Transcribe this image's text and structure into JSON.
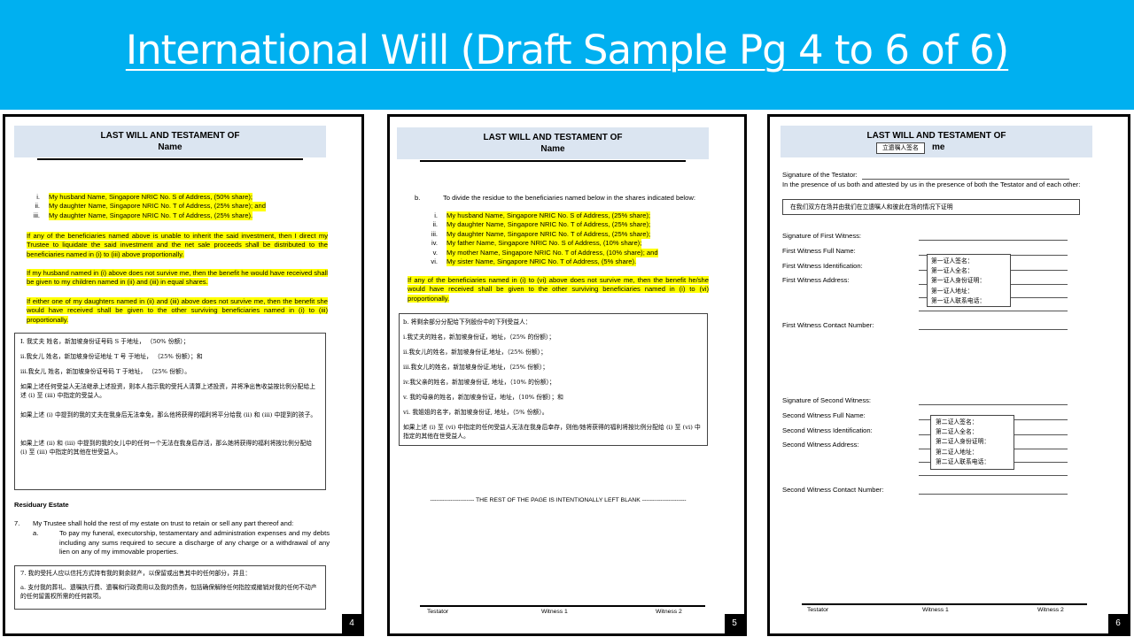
{
  "slide": {
    "title": "International Will (Draft Sample Pg 4 to 6 of 6)"
  },
  "doc": {
    "header_line1": "LAST WILL AND TESTAMENT OF",
    "header_line2": "Name"
  },
  "footer": {
    "testator": "Testator",
    "witness1": "Witness 1",
    "witness2": "Witness 2"
  },
  "p4": {
    "number": "4",
    "list": [
      {
        "num": "i.",
        "text": "My husband Name, Singapore NRIC No. S of Address, (50% share);"
      },
      {
        "num": "ii.",
        "text": "My daughter Name, Singapore NRIC No. T of Address, (25% share); and"
      },
      {
        "num": "iii.",
        "text": "My daughter Name, Singapore NRIC No. T of Address, (25% share)."
      }
    ],
    "para1": "If any of the beneficiaries named above is unable to inherit the said investment, then I direct my Trustee to liquidate the said investment and the net sale proceeds shall be distributed to the beneficiaries named in (i) to (iii) above proportionally.",
    "para2": "If my husband named in (i) above does not survive me, then the benefit he would have received shall be given to my children named in (ii) and (iii) in equal shares.",
    "para3": "If either one of my daughters named in (ii) and (iii) above does not survive me, then the benefit she would have received shall be given to the other surviving beneficiaries named in (i) to (iii) proportionally.",
    "cn_lines": [
      "I.  我丈夫 姓名，新加坡身份证号码 S 于地址， （50% 份额）；",
      "ii.我女儿 姓名，新加坡身份证地址 T 号 于地址， （25% 份额）；和",
      "iii.我女儿 姓名，新加坡身份证号码 T 于地址， （25% 份额）。"
    ],
    "cn_para1": "如果上述任何受益人无法继承上述投资，则本人指示我的受托人清算上述投资，并将净出售收益按比例分配给上述 (i) 至 (iii) 中指定的受益人。",
    "cn_para2": "如果上述 (i) 中提到的我的丈夫在我身后无法幸免，那么他将获得的福利将平分给我 (ii) 和 (iii) 中提到的孩子。",
    "cn_para3": "如果上述 (ii) 和 (iii) 中提到的我的女儿中的任何一个无法在我身后存活，那么她将获得的福利将按比例分配给 (i) 至 (iii) 中指定的其他在世受益人。",
    "residuary_heading": "Residuary Estate",
    "clause7_num": "7.",
    "clause7": "My Trustee shall hold the rest of my estate on trust to retain or sell any part thereof and:",
    "clause7a_num": "a.",
    "clause7a": "To pay my funeral, executorship, testamentary and administration expenses and my debts including any sums required to secure a discharge of any charge or a withdrawal of any lien on any of my immovable properties.",
    "cn_box2_line1": "7. 我的受托人应以信托方式持有我的剩余财产，以保留或出售其中的任何部分，并且：",
    "cn_box2_line2": "a.  支付我的葬礼、遗嘱执行费、遗嘱和行政费用以及我的债务，包括确保解除任何指控或撤销对我的任何不动产的任何留置权所需的任何款项。"
  },
  "p5": {
    "number": "5",
    "b_num": "b.",
    "b_text": "To divide the residue to the beneficiaries named below in the shares indicated below:",
    "list": [
      {
        "num": "i.",
        "text": "My husband Name, Singapore NRIC No. S of Address, (25% share);"
      },
      {
        "num": "ii.",
        "text": "My daughter Name, Singapore NRIC No. T of Address, (25% share);"
      },
      {
        "num": "iii.",
        "text": "My daughter Name, Singapore NRIC No. T of Address, (25% share);"
      },
      {
        "num": "iv.",
        "text": "My father Name, Singapore NRIC No. S of Address, (10% share);"
      },
      {
        "num": "v.",
        "text": "My mother Name, Singapore NRIC No. T of Address, (10% share); and"
      },
      {
        "num": "vi.",
        "text": "My sister Name, Singapore NRIC No. T of Address, (5% share)."
      }
    ],
    "para": "If any of the beneficiaries named in (i) to (vi) above does not survive me, then the benefit he/she would have received shall be given to the other surviving beneficiaries named in (i) to (vi) proportionally.",
    "cn_lines": [
      "b. 将剩余部分分配给下列股份中的下列受益人：",
      "i.我丈夫的姓名，新加坡身份证，地址，（25% 的份额）；",
      "ii.我女儿的姓名，新加坡身份证,地址，（25% 份额）；",
      "iii.我女儿的姓名，新加坡身份证,地址，（25% 份额）；",
      "iv.我父亲的姓名，新加坡身份证, 地址，（10% 的份额）；",
      "v. 我的母亲的姓名，新加坡身份证，地址，（10% 份额）；和",
      "vi. 我姐姐的名字，新加坡身份证, 地址，（5% 份额）。"
    ],
    "cn_para": "如果上述 (i) 至 (vi) 中指定的任何受益人无法在我身后幸存，则他/她将获得的福利将按比例分配给 (i) 至 (vi) 中指定的其他在世受益人。",
    "blank_notice": "---------------------- THE REST OF THE PAGE IS INTENTIONALLY LEFT BLANK ----------------------"
  },
  "p6": {
    "number": "6",
    "header_overlay": "立遗嘱人签名",
    "header_tail": "me",
    "testator_sig": "Signature of the Testator:",
    "presence": "In the presence of us both and attested by us in the presence of both the Testator and of each other:",
    "presence_cn": "在我们双方在场并由我们在立遗嘱人和彼此在场的情况下证明",
    "w1_sig": "Signature of First Witness:",
    "w1_name": "First Witness Full Name:",
    "w1_id": "First Witness Identification:",
    "w1_addr": "First Witness Address:",
    "w1_contact": "First Witness Contact Number:",
    "w2_sig": "Signature of Second Witness:",
    "w2_name": "Second Witness Full Name:",
    "w2_id": "Second Witness Identification:",
    "w2_addr": "Second Witness Address:",
    "w2_contact": "Second Witness Contact Number:",
    "witness_box_items": [
      "第一证人签名：",
      "第一证人全名：",
      "第一证人身份证明：",
      "第一证人地址：",
      "第一证人联系电话："
    ],
    "witness2_box_items": [
      "第二证人签名：",
      "第二证人全名：",
      "第二证人身份证明：",
      "第二证人地址：",
      "第二证人联系电话："
    ]
  }
}
